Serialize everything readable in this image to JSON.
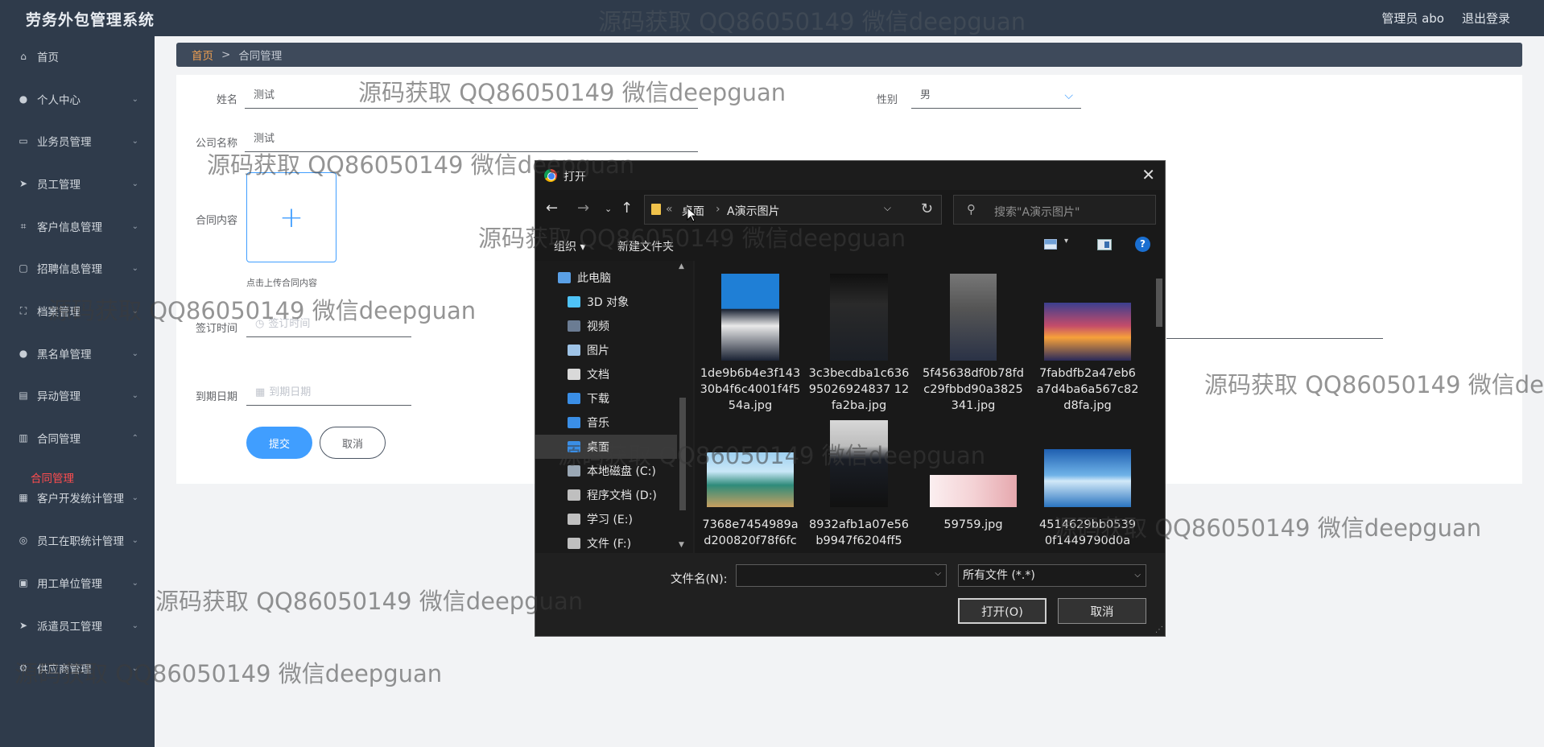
{
  "app": {
    "title": "劳务外包管理系统",
    "user_label": "管理员 abo",
    "logout_label": "退出登录"
  },
  "sidebar": {
    "items": [
      {
        "label": "首页",
        "icon": "home-icon"
      },
      {
        "label": "个人中心",
        "icon": "user-icon"
      },
      {
        "label": "业务员管理",
        "icon": "chat-icon"
      },
      {
        "label": "员工管理",
        "icon": "send-icon"
      },
      {
        "label": "客户信息管理",
        "icon": "crop-icon"
      },
      {
        "label": "招聘信息管理",
        "icon": "message-icon"
      },
      {
        "label": "档案管理",
        "icon": "frame-icon"
      },
      {
        "label": "黑名单管理",
        "icon": "user-icon"
      },
      {
        "label": "异动管理",
        "icon": "clipboard-icon"
      },
      {
        "label": "合同管理",
        "icon": "chart-icon"
      },
      {
        "label": "客户开发统计管理",
        "icon": "grid-icon"
      },
      {
        "label": "员工在职统计管理",
        "icon": "compass-icon"
      },
      {
        "label": "用工单位管理",
        "icon": "folder-icon"
      },
      {
        "label": "派遣员工管理",
        "icon": "send-icon"
      },
      {
        "label": "供应商管理",
        "icon": "gear-icon"
      }
    ],
    "active_sub": "合同管理"
  },
  "breadcrumb": {
    "home": "首页",
    "separator": ">",
    "current": "合同管理"
  },
  "form": {
    "name_label": "姓名",
    "name_value": "测试",
    "gender_label": "性别",
    "gender_value": "男",
    "company_label": "公司名称",
    "company_value": "测试",
    "content_label": "合同内容",
    "upload_hint": "点击上传合同内容",
    "sign_label": "签订时间",
    "sign_placeholder": "签订时间",
    "expire_label": "到期日期",
    "expire_placeholder": "到期日期",
    "submit_label": "提交",
    "cancel_label": "取消"
  },
  "watermark": "源码获取 QQ86050149 微信deepguan",
  "dialog": {
    "title": "打开",
    "path_root": "桌面",
    "path_folder": "A演示图片",
    "path_sep": "›",
    "path_more": "«",
    "search_placeholder": "搜索\"A演示图片\"",
    "organize_label": "组织 ▾",
    "new_folder_label": "新建文件夹",
    "tree": [
      {
        "label": "此电脑",
        "color": "#5aa0e6"
      },
      {
        "label": "3D 对象",
        "color": "#4fc3f7"
      },
      {
        "label": "视频",
        "color": "#6b7c93"
      },
      {
        "label": "图片",
        "color": "#9ec3e6"
      },
      {
        "label": "文档",
        "color": "#d9d9d9"
      },
      {
        "label": "下载",
        "color": "#3a8ee6"
      },
      {
        "label": "音乐",
        "color": "#3a8ee6"
      },
      {
        "label": "桌面",
        "color": "#3a8ee6"
      },
      {
        "label": "本地磁盘 (C:)",
        "color": "#9aa7b4"
      },
      {
        "label": "程序文档 (D:)",
        "color": "#bfbfbf"
      },
      {
        "label": "学习 (E:)",
        "color": "#bfbfbf"
      },
      {
        "label": "文件 (F:)",
        "color": "#bfbfbf"
      }
    ],
    "files": [
      {
        "name": "1de9b6b4e3f14330b4f6c4001f4f554a.jpg",
        "thumb": "portrait-blue"
      },
      {
        "name": "3c3becdba1c63695026924837 12fa2ba.jpg",
        "thumb": "portrait-dark"
      },
      {
        "name": "5f45638df0b78fdc29fbbd90a3825341.jpg",
        "thumb": "portrait-gray"
      },
      {
        "name": "7fabdfb2a47eb6a7d4ba6a567c82d8fa.jpg",
        "thumb": "sunset"
      },
      {
        "name": "7368e7454989ad200820f78f6fc",
        "thumb": "beach"
      },
      {
        "name": "8932afb1a07e56b9947f6204ff5",
        "thumb": "portrait-dark2"
      },
      {
        "name": "59759.jpg",
        "thumb": "card"
      },
      {
        "name": "4514629bb05390f1449790d0a",
        "thumb": "lake"
      }
    ],
    "filename_label": "文件名(N):",
    "filename_value": "",
    "filetype_value": "所有文件 (*.*)",
    "open_label": "打开(O)",
    "cancel_label": "取消"
  }
}
